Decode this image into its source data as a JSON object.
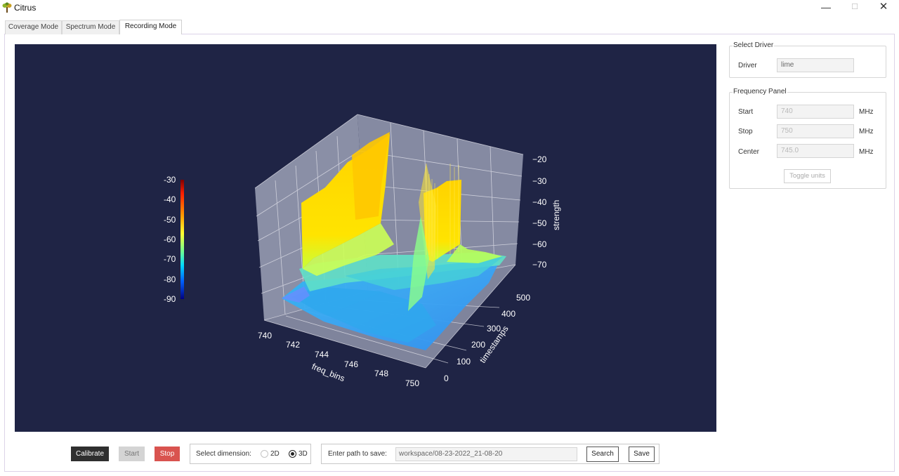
{
  "window": {
    "title": "Citrus",
    "minimize_glyph": "—",
    "maximize_glyph": "☐",
    "close_glyph": "✕"
  },
  "tabs": [
    {
      "label": "Coverage Mode",
      "active": false
    },
    {
      "label": "Spectrum Mode",
      "active": false
    },
    {
      "label": "Recording Mode",
      "active": true
    }
  ],
  "plot": {
    "colorbar_ticks": [
      "-30",
      "-40",
      "-50",
      "-60",
      "-70",
      "-80",
      "-90"
    ],
    "z_ticks": [
      "−20",
      "−30",
      "−40",
      "−50",
      "−60",
      "−70"
    ],
    "z_label": "strength",
    "x_ticks": [
      "740",
      "742",
      "744",
      "746",
      "748",
      "750"
    ],
    "x_label": "freq_bins",
    "y_ticks": [
      "0",
      "100",
      "200",
      "300",
      "400",
      "500"
    ],
    "y_label": "timestamps",
    "colors": {
      "background": "#1f2445",
      "pane": "#8a8fa6",
      "grid": "#e6e6ee"
    }
  },
  "driver": {
    "title": "Select Driver",
    "label": "Driver",
    "value": "lime"
  },
  "frequency": {
    "title": "Frequency Panel",
    "start_label": "Start",
    "start_value": "740",
    "stop_label": "Stop",
    "stop_value": "750",
    "center_label": "Center",
    "center_value": "745.0",
    "unit": "MHz",
    "toggle_label": "Toggle units"
  },
  "controls": {
    "calibrate": "Calibrate",
    "start": "Start",
    "stop": "Stop",
    "dimension_label": "Select dimension:",
    "dim_2d": "2D",
    "dim_3d": "3D",
    "dim_selected": "3D",
    "path_label": "Enter path to save:",
    "path_value": "workspace/08-23-2022_21-08-20",
    "search": "Search",
    "save": "Save"
  }
}
